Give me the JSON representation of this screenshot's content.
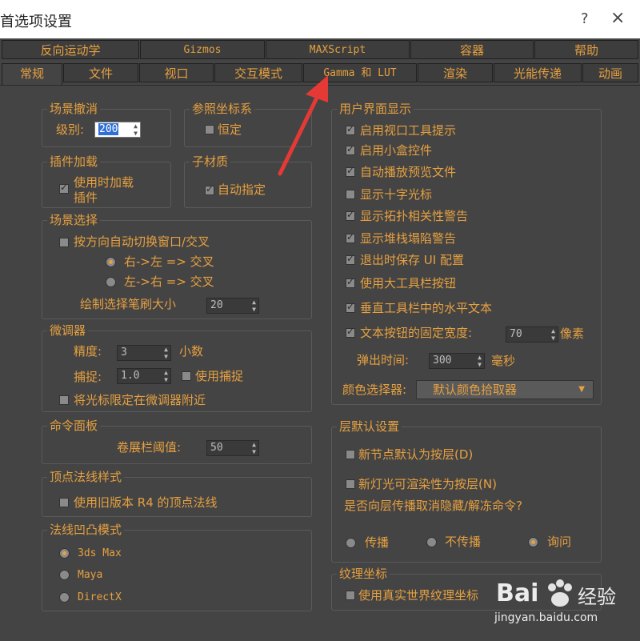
{
  "window": {
    "title": "首选项设置",
    "help": "?",
    "close": "×"
  },
  "tabs_row1": [
    "反向运动学",
    "Gizmos",
    "MAXScript",
    "容器",
    "帮助"
  ],
  "tabs_row2": [
    "常规",
    "文件",
    "视口",
    "交互模式",
    "Gamma 和 LUT",
    "渲染",
    "光能传递",
    "动画"
  ],
  "scene_undo": {
    "title": "场景撤消",
    "level_label": "级别:",
    "level_value": "200"
  },
  "ref_coord": {
    "title": "参照坐标系",
    "constant_label": "恒定"
  },
  "plugin_loading": {
    "title": "插件加载",
    "load_line1": "使用时加载",
    "load_line2": "插件"
  },
  "sub_material": {
    "title": "子材质",
    "auto_assign": "自动指定"
  },
  "scene_selection": {
    "title": "场景选择",
    "auto_switch": "按方向自动切换窗口/交叉",
    "right_left": "右->左 => 交叉",
    "left_right": "左->右 => 交叉",
    "brush_label": "绘制选择笔刷大小",
    "brush_value": "20"
  },
  "spinners": {
    "title": "微调器",
    "precision_label": "精度:",
    "precision_value": "3",
    "decimals_label": "小数",
    "snap_label": "捕捉:",
    "snap_value": "1.0",
    "use_snap_label": "使用捕捉",
    "limit_cursor": "将光标限定在微调器附近"
  },
  "command_panel": {
    "title": "命令面板",
    "threshold_label": "卷展栏阈值:",
    "threshold_value": "50"
  },
  "vertex_normal": {
    "title": "顶点法线样式",
    "legacy_r4": "使用旧版本 R4 的顶点法线"
  },
  "bump_mode": {
    "title": "法线凹凸模式",
    "opt_3ds": "3ds Max",
    "opt_maya": "Maya",
    "opt_directx": "DirectX"
  },
  "ui_display": {
    "title": "用户界面显示",
    "items": [
      "启用视口工具提示",
      "启用小盒控件",
      "自动播放预览文件",
      "显示十字光标",
      "显示拓扑相关性警告",
      "显示堆栈塌陷警告",
      "退出时保存 UI 配置",
      "使用大工具栏按钮",
      "垂直工具栏中的水平文本"
    ],
    "fixed_width_label": "文本按钮的固定宽度:",
    "fixed_width_value": "70",
    "pixel_unit": "像素",
    "flyout_label": "弹出时间:",
    "flyout_value": "300",
    "ms_unit": "毫秒",
    "color_picker_label": "颜色选择器:",
    "color_picker_value": "默认颜色拾取器"
  },
  "layer_defaults": {
    "title": "层默认设置",
    "new_nodes": "新节点默认为按层(D)",
    "new_lights": "新灯光可渲染性为按层(N)",
    "propagate_q": "是否向层传播取消隐藏/解冻命令?",
    "propagate": "传播",
    "no_propagate": "不传播",
    "ask": "询问"
  },
  "texture_coords": {
    "title": "纹理坐标",
    "real_world": "使用真实世界纹理坐标"
  },
  "watermark": {
    "brand": "Bai",
    "brand2": "经验",
    "url": "jingyan.baidu.com"
  },
  "colors": {
    "accent": "#e6a040",
    "bg": "#444444",
    "annotation_arrow": "#e53935"
  }
}
